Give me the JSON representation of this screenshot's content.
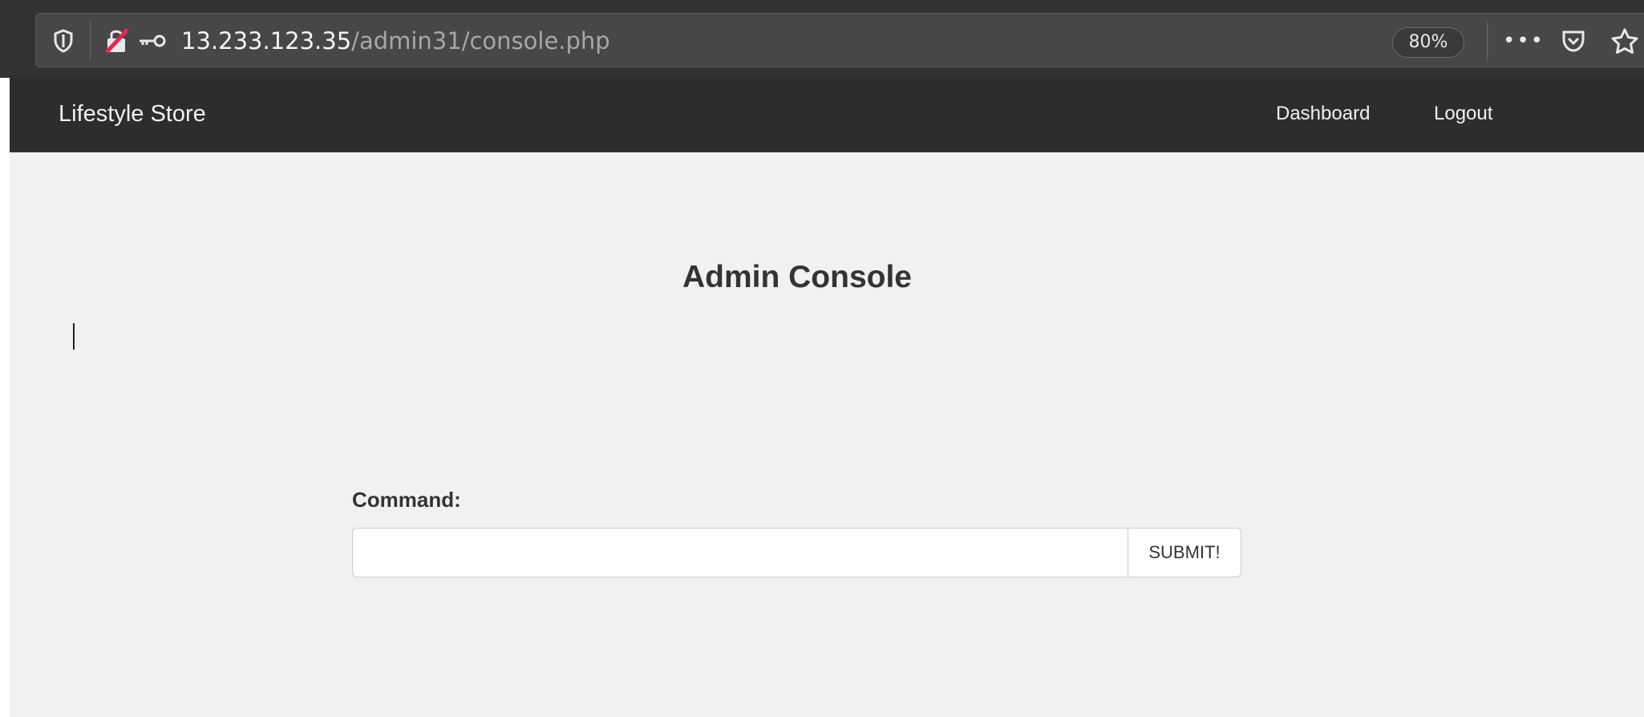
{
  "browser": {
    "url_host": "13.233.123.35",
    "url_path": "/admin31/console.php",
    "zoom": "80%",
    "icons": {
      "shield": "tracking-protection-shield-icon",
      "insecure_lock": "insecure-lock-icon",
      "key": "key-icon",
      "more": "more-options-icon",
      "pocket": "pocket-icon",
      "bookmark": "bookmark-star-icon"
    }
  },
  "navbar": {
    "brand": "Lifestyle Store",
    "links": [
      {
        "label": "Dashboard"
      },
      {
        "label": "Logout"
      }
    ]
  },
  "main": {
    "title": "Admin Console",
    "form": {
      "label": "Command:",
      "input_value": "",
      "input_placeholder": "",
      "submit_label": "SUBMIT!"
    }
  },
  "colors": {
    "browser_bar": "#323234",
    "navbar_bg": "#2d2d2d",
    "content_bg": "#f1f1f1",
    "insecure_red": "#e22850"
  }
}
